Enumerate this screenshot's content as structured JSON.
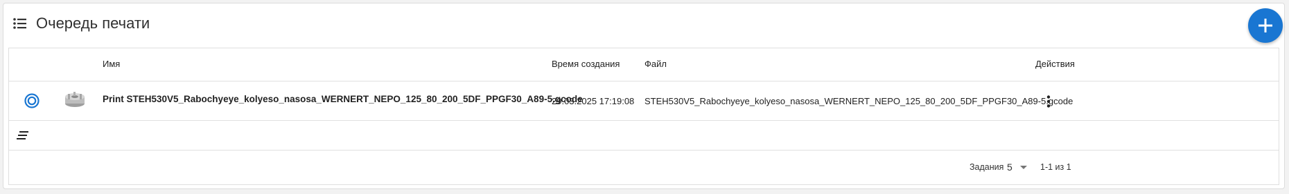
{
  "header": {
    "icon": "list-icon",
    "title": "Очередь печати",
    "add_button_icon": "plus-icon",
    "add_button_color": "#1976d2"
  },
  "table": {
    "columns": [
      "",
      "",
      "Имя",
      "Время создания",
      "Файл",
      "Действия"
    ],
    "rows": [
      {
        "status_icon": "queued-target-icon",
        "thumbnail": "gcode-part-thumbnail",
        "name": "Print STEH530V5_Rabochyeye_kolyeso_nasosa_WERNERT_NEPO_125_80_200_5DF_PPGF30_A89-5.gcode",
        "created": "29.03.2025 17:19:08",
        "file": "STEH530V5_Rabochyeye_kolyeso_nasosa_WERNERT_NEPO_125_80_200_5DF_PPGF30_A89-5.gcode",
        "actions_icon": "more-vert-icon"
      }
    ],
    "group_icon": "sort-lines-icon"
  },
  "footer": {
    "per_page_label": "Задания",
    "per_page_value": "5",
    "range_text": "1-1 из 1"
  }
}
